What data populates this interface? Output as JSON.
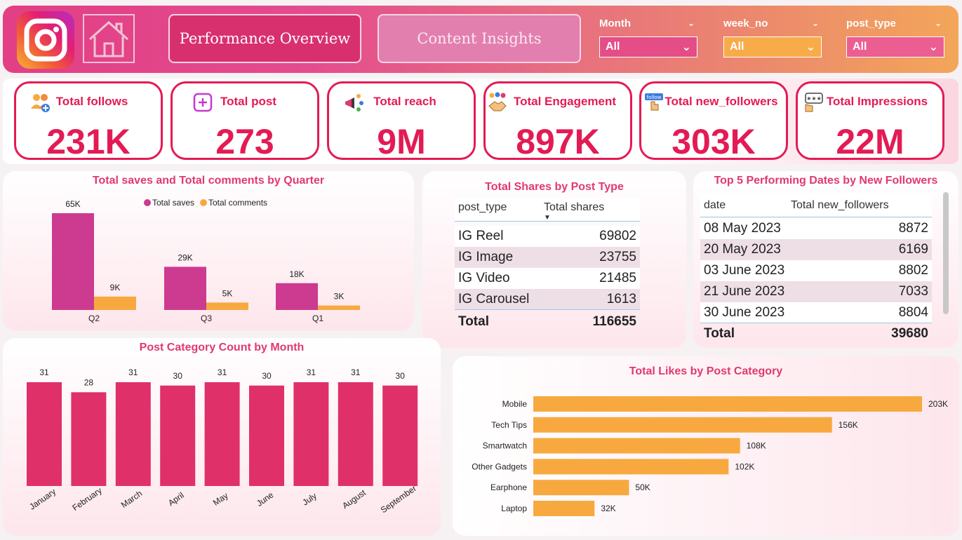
{
  "nav": {
    "performance_label": "Performance Overview",
    "content_label": "Content Insights"
  },
  "slicers": {
    "month": {
      "label": "Month",
      "value": "All"
    },
    "week_no": {
      "label": "week_no",
      "value": "All"
    },
    "post_type": {
      "label": "post_type",
      "value": "All"
    }
  },
  "kpis": [
    {
      "title": "Total follows",
      "value": "231K",
      "icon": "people-add-icon"
    },
    {
      "title": "Total post",
      "value": "273",
      "icon": "plus-square-icon"
    },
    {
      "title": "Total reach",
      "value": "9M",
      "icon": "megaphone-icon"
    },
    {
      "title": "Total Engagement",
      "value": "897K",
      "icon": "handshake-icon"
    },
    {
      "title": "Total new_followers",
      "value": "303K",
      "icon": "follow-icon"
    },
    {
      "title": "Total Impressions",
      "value": "22M",
      "icon": "rating-icon"
    }
  ],
  "follow_badge": "follow",
  "colors": {
    "primary": "#e31b54",
    "accent": "#f7a940",
    "magenta": "#cc3b8f",
    "bar": "#e0306a"
  },
  "chart_data": [
    {
      "type": "bar",
      "title": "Total saves and Total comments by Quarter",
      "categories": [
        "Q2",
        "Q3",
        "Q1"
      ],
      "series": [
        {
          "name": "Total saves",
          "values": [
            65000,
            29000,
            18000
          ],
          "labels": [
            "65K",
            "29K",
            "18K"
          ]
        },
        {
          "name": "Total comments",
          "values": [
            9000,
            5000,
            3000
          ],
          "labels": [
            "9K",
            "5K",
            "3K"
          ]
        }
      ],
      "legend": "top-center"
    },
    {
      "type": "bar",
      "title": "Post Category Count by Month",
      "categories": [
        "January",
        "February",
        "March",
        "April",
        "May",
        "June",
        "July",
        "August",
        "September"
      ],
      "values": [
        31,
        28,
        31,
        30,
        31,
        30,
        31,
        31,
        30
      ]
    },
    {
      "type": "bar",
      "orientation": "horizontal",
      "title": "Total Likes by Post Category",
      "categories": [
        "Mobile",
        "Tech Tips",
        "Smartwatch",
        "Other Gadgets",
        "Earphone",
        "Laptop"
      ],
      "values": [
        203000,
        156000,
        108000,
        102000,
        50000,
        32000
      ],
      "labels": [
        "203K",
        "156K",
        "108K",
        "102K",
        "50K",
        "32K"
      ]
    }
  ],
  "shares_table": {
    "title": "Total Shares by Post Type",
    "columns": [
      "post_type",
      "Total shares"
    ],
    "sort_indicator": "▼",
    "rows": [
      {
        "type": "IG Reel",
        "shares": "69802"
      },
      {
        "type": "IG Image",
        "shares": "23755"
      },
      {
        "type": "IG Video",
        "shares": "21485"
      },
      {
        "type": "IG Carousel",
        "shares": "1613"
      }
    ],
    "total_label": "Total",
    "total_value": "116655"
  },
  "followers_table": {
    "title": "Top 5 Performing Dates by New Followers",
    "columns": [
      "date",
      "Total new_followers"
    ],
    "rows": [
      {
        "date": "08 May 2023",
        "value": "8872"
      },
      {
        "date": "20 May 2023",
        "value": "6169"
      },
      {
        "date": "03 June 2023",
        "value": "8802"
      },
      {
        "date": "21 June 2023",
        "value": "7033"
      },
      {
        "date": "30 June 2023",
        "value": "8804"
      }
    ],
    "total_label": "Total",
    "total_value": "39680"
  }
}
